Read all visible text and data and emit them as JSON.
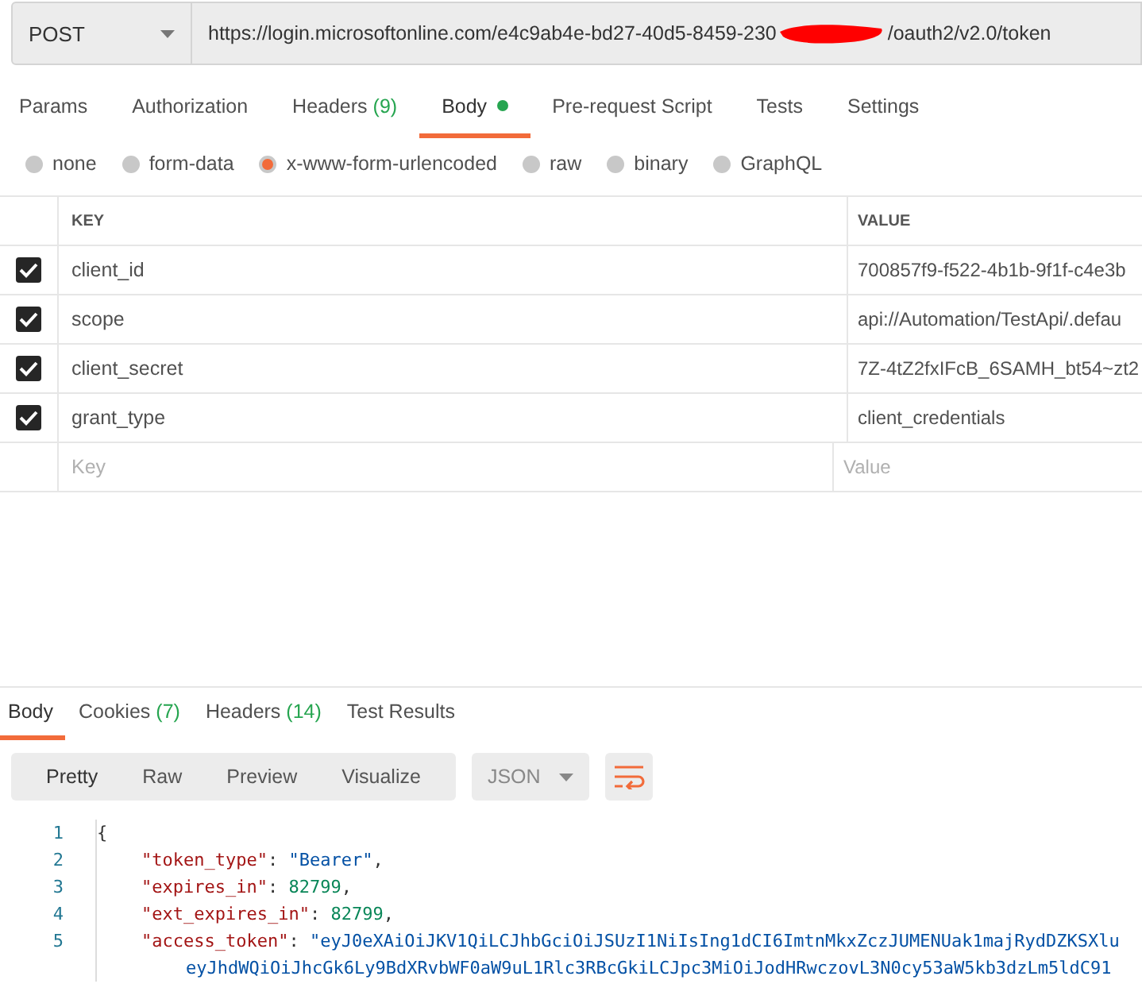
{
  "request": {
    "method": "POST",
    "url_start": "https://login.microsoftonline.com/e4c9ab4e-bd27-40d5-8459-230",
    "url_end": "/oauth2/v2.0/token"
  },
  "request_tabs": [
    {
      "label": "Params",
      "selected": false
    },
    {
      "label": "Authorization",
      "selected": false
    },
    {
      "label": "Headers",
      "count": "(9)",
      "selected": false
    },
    {
      "label": "Body",
      "dot": true,
      "selected": true
    },
    {
      "label": "Pre-request Script",
      "selected": false
    },
    {
      "label": "Tests",
      "selected": false
    },
    {
      "label": "Settings",
      "selected": false
    }
  ],
  "body_types": [
    {
      "label": "none",
      "selected": false
    },
    {
      "label": "form-data",
      "selected": false
    },
    {
      "label": "x-www-form-urlencoded",
      "selected": true
    },
    {
      "label": "raw",
      "selected": false
    },
    {
      "label": "binary",
      "selected": false
    },
    {
      "label": "GraphQL",
      "selected": false
    }
  ],
  "params_table": {
    "columns": [
      "KEY",
      "VALUE"
    ],
    "rows": [
      {
        "key": "client_id",
        "value": "700857f9-f522-4b1b-9f1f-c4e3b",
        "checked": true
      },
      {
        "key": "scope",
        "value": "api://Automation/TestApi/.defau",
        "checked": true
      },
      {
        "key": "client_secret",
        "value": "7Z-4tZ2fxIFcB_6SAMH_bt54~zt2",
        "checked": true
      },
      {
        "key": "grant_type",
        "value": "client_credentials",
        "checked": true
      }
    ],
    "new_row": {
      "key_placeholder": "Key",
      "value_placeholder": "Value"
    }
  },
  "response_tabs": [
    {
      "label": "Body",
      "selected": true
    },
    {
      "label": "Cookies",
      "count": "(7)",
      "selected": false
    },
    {
      "label": "Headers",
      "count": "(14)",
      "selected": false
    },
    {
      "label": "Test Results",
      "selected": false
    }
  ],
  "view_modes": [
    {
      "label": "Pretty",
      "selected": true
    },
    {
      "label": "Raw",
      "selected": false
    },
    {
      "label": "Preview",
      "selected": false
    },
    {
      "label": "Visualize",
      "selected": false
    }
  ],
  "format": "JSON",
  "code_lines": [
    {
      "number": "1",
      "kind": "brace",
      "tokens": [
        {
          "kind": "punct",
          "text": "{"
        }
      ]
    },
    {
      "number": "2",
      "kind": "member",
      "tokens": [
        {
          "kind": "key",
          "text": "\"token_type\""
        },
        {
          "kind": "punct",
          "text": ": "
        },
        {
          "kind": "string",
          "text": "\"Bearer\""
        },
        {
          "kind": "punct",
          "text": ","
        }
      ]
    },
    {
      "number": "3",
      "kind": "member",
      "tokens": [
        {
          "kind": "key",
          "text": "\"expires_in\""
        },
        {
          "kind": "punct",
          "text": ": "
        },
        {
          "kind": "number",
          "text": "82799"
        },
        {
          "kind": "punct",
          "text": ","
        }
      ]
    },
    {
      "number": "4",
      "kind": "member",
      "tokens": [
        {
          "kind": "key",
          "text": "\"ext_expires_in\""
        },
        {
          "kind": "punct",
          "text": ": "
        },
        {
          "kind": "number",
          "text": "82799"
        },
        {
          "kind": "punct",
          "text": ","
        }
      ]
    },
    {
      "number": "5",
      "kind": "member",
      "tokens": [
        {
          "kind": "key",
          "text": "\"access_token\""
        },
        {
          "kind": "punct",
          "text": ": "
        },
        {
          "kind": "string",
          "text": "\"eyJ0eXAiOiJKV1QiLCJhbGciOiJSUzI1NiIsIng1dCI6ImtnMkxZczJUMENUak1majRydDZKSXlu"
        }
      ]
    },
    {
      "kind": "continuation",
      "tokens": [
        {
          "kind": "string",
          "text": "eyJhdWQiOiJhcGk6Ly9BdXRvbWF0aW9uL1Rlc3RBcGkiLCJpc3MiOiJodHRwczovL3N0cy53aW5kb3dzLm5ldC91"
        }
      ]
    }
  ]
}
